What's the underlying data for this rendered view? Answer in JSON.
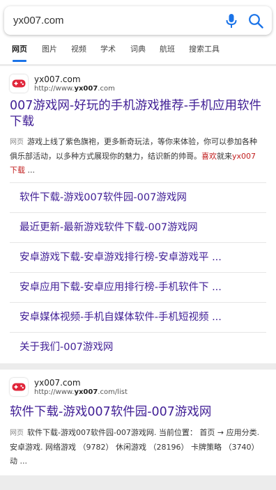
{
  "search": {
    "query": "yx007.com",
    "mic_icon": "microphone-icon",
    "search_icon": "search-icon",
    "accent_color": "#1a73e8"
  },
  "tabs": [
    {
      "label": "网页",
      "active": true
    },
    {
      "label": "图片",
      "active": false
    },
    {
      "label": "视频",
      "active": false
    },
    {
      "label": "学术",
      "active": false
    },
    {
      "label": "词典",
      "active": false
    },
    {
      "label": "航班",
      "active": false
    },
    {
      "label": "搜索工具",
      "active": false
    }
  ],
  "results": [
    {
      "site_name": "yx007.com",
      "url_prefix": "http://www.",
      "url_bold": "yx007",
      "url_suffix": ".com",
      "logo_icon": "gamepad-icon",
      "title": "007游戏网-好玩的手机游戏推荐-手机应用软件下载",
      "snippet_tag": "网页",
      "snippet_text": "游戏上线了紫色旗袍，更多新奇玩法，等你来体验，你可以参加各种俱乐部活动，以多种方式展现你的魅力，结识新的帅哥。",
      "snippet_hl1": "喜欢",
      "snippet_mid": "就来",
      "snippet_hl2": "yx007下载",
      "snippet_end": " ...",
      "sublinks": [
        "软件下载-游戏007软件园-007游戏网",
        "最近更新-最新游戏软件下载-007游戏网",
        "安卓游戏下载-安卓游戏排行榜-安卓游戏平 ...",
        "安卓应用下载-安卓应用排行榜-手机软件下 ...",
        "安卓媒体视频-手机自媒体软件-手机短视频 ...",
        "关于我们-007游戏网"
      ]
    },
    {
      "site_name": "yx007.com",
      "url_prefix": "http://www.",
      "url_bold": "yx007",
      "url_suffix": ".com/list",
      "logo_icon": "gamepad-icon",
      "title": "软件下载-游戏007软件园-007游戏网",
      "snippet_tag": "网页",
      "snippet_text": "软件下载-游戏007软件园-007游戏网. 当前位置： 首页 → 应用分类. 安卓游戏. 网络游戏 （9782） 休闲游戏 （28196） 卡牌策略 （3740） 动 ..."
    }
  ]
}
